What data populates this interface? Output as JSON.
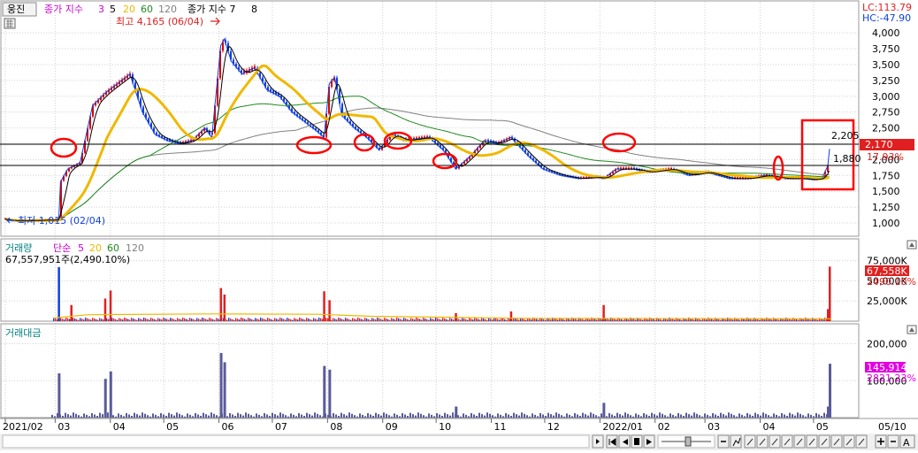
{
  "stock_name": "웅진",
  "price_panel": {
    "title": "종가 지수",
    "ma_periods": [
      {
        "label": "3",
        "color": "#d000d0"
      },
      {
        "label": "5",
        "color": "#000000"
      },
      {
        "label": "20",
        "color": "#f0b800"
      },
      {
        "label": "60",
        "color": "#1f8a1f"
      },
      {
        "label": "120",
        "color": "#808080"
      }
    ],
    "index2_label": "종가 지수 7",
    "index3_label": "8",
    "lc": "LC:113.79",
    "hc": "HC:-47.90",
    "high_label": "최고 4,165 (06/04)",
    "low_label": "최저 1,015 (02/04)",
    "right_labels": {
      "top_value": "2,205",
      "current_price": "2,170",
      "change_pct": "17.93%",
      "lower_value": "1,880"
    },
    "colors": {
      "up": "#e00000",
      "down": "#1040e0",
      "ma5": "#000000",
      "ma20": "#f0b800",
      "ma60": "#1f8a1f",
      "ma120": "#808080",
      "annotation": "#ff0000"
    }
  },
  "volume_panel": {
    "title": "거래량",
    "sub": "단순",
    "ma_periods": [
      {
        "label": "5",
        "color": "#d000d0"
      },
      {
        "label": "20",
        "color": "#f0b800"
      },
      {
        "label": "60",
        "color": "#1f8a1f"
      },
      {
        "label": "120",
        "color": "#808080"
      }
    ],
    "info": "67,557,951주(2,490.10%)",
    "right_labels": {
      "current": "67,558K",
      "pct": "2490.10%"
    }
  },
  "amount_panel": {
    "title": "거래대금",
    "right_labels": {
      "current": "145,914",
      "pct": "2821.23%"
    }
  },
  "time_axis": [
    "2021/02",
    "03",
    "04",
    "05",
    "06",
    "07",
    "08",
    "09",
    "10",
    "11",
    "12",
    "2022/01",
    "02",
    "03",
    "04",
    "05",
    "05/10"
  ],
  "chart_data": [
    {
      "type": "line",
      "title": "종가 지수",
      "x": [
        "2021/02/01",
        "2021/02/05",
        "2021/03/03",
        "2021/03/04",
        "2021/03/08",
        "2021/03/15",
        "2021/03/22",
        "2021/03/29",
        "2021/04/05",
        "2021/04/12",
        "2021/04/19",
        "2021/04/26",
        "2021/05/03",
        "2021/05/10",
        "2021/05/17",
        "2021/05/24",
        "2021/05/28",
        "2021/06/02",
        "2021/06/04",
        "2021/06/08",
        "2021/06/14",
        "2021/06/21",
        "2021/06/28",
        "2021/07/05",
        "2021/07/12",
        "2021/07/19",
        "2021/07/26",
        "2021/07/30",
        "2021/08/02",
        "2021/08/05",
        "2021/08/09",
        "2021/08/16",
        "2021/08/23",
        "2021/08/30",
        "2021/09/06",
        "2021/09/13",
        "2021/09/27",
        "2021/10/01",
        "2021/10/05",
        "2021/10/12",
        "2021/10/20",
        "2021/10/28",
        "2021/11/04",
        "2021/11/12",
        "2021/11/22",
        "2021/11/30",
        "2021/12/10",
        "2021/12/20",
        "2021/12/30",
        "2022/01/03",
        "2022/01/10",
        "2022/01/20",
        "2022/01/28",
        "2022/02/10",
        "2022/02/20",
        "2022/03/02",
        "2022/03/15",
        "2022/03/25",
        "2022/04/04",
        "2022/04/15",
        "2022/04/25",
        "2022/05/02",
        "2022/05/06",
        "2022/05/09",
        "2022/05/10"
      ],
      "series": [
        {
          "values": [
            1060,
            1030,
            1050,
            1650,
            1850,
            1950,
            2850,
            3050,
            3200,
            3350,
            2750,
            2400,
            2300,
            2250,
            2300,
            2500,
            2350,
            3800,
            3900,
            3550,
            3350,
            3450,
            3100,
            3000,
            2750,
            2600,
            2450,
            2350,
            3200,
            3300,
            2700,
            2500,
            2350,
            2150,
            2400,
            2300,
            2350,
            2250,
            2150,
            1850,
            2050,
            2300,
            2250,
            2350,
            2050,
            1850,
            1750,
            1700,
            1720,
            1700,
            1850,
            1850,
            1800,
            1850,
            1750,
            1800,
            1700,
            1700,
            1750,
            1700,
            1700,
            1680,
            1720,
            1900,
            2170
          ]
        }
      ],
      "ylim": [
        1000,
        4100
      ],
      "yticks": [
        1000,
        1250,
        1500,
        1750,
        2000,
        2250,
        2500,
        2750,
        3000,
        3250,
        3500,
        3750,
        4000
      ]
    },
    {
      "type": "bar",
      "title": "거래량",
      "x": [
        "2021/03/03",
        "2021/03/10",
        "2021/03/29",
        "2021/04/01",
        "2021/06/02",
        "2021/06/04",
        "2021/07/30",
        "2021/08/02",
        "2021/10/12",
        "2021/11/12",
        "2022/01/03",
        "2022/05/09",
        "2022/05/10"
      ],
      "values": [
        67000,
        20000,
        28000,
        38000,
        41000,
        33000,
        37000,
        26000,
        10000,
        12000,
        20000,
        15000,
        67558
      ],
      "yticks": [
        25000,
        50000,
        75000
      ]
    },
    {
      "type": "bar",
      "title": "거래대금",
      "x": [
        "2021/03/03",
        "2021/03/29",
        "2021/04/01",
        "2021/06/02",
        "2021/06/04",
        "2021/07/30",
        "2021/08/02",
        "2021/10/12",
        "2022/01/03",
        "2022/05/09",
        "2022/05/10"
      ],
      "values": [
        120000,
        105000,
        125000,
        175000,
        150000,
        140000,
        130000,
        30000,
        40000,
        30000,
        145914
      ],
      "yticks": [
        100000,
        200000
      ]
    }
  ]
}
